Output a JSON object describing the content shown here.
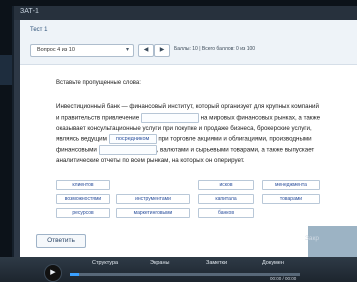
{
  "window": {
    "title": "ЗАТ-1"
  },
  "header": {
    "test_title": "Тест 1",
    "question_select": "Вопрос 4 из 10",
    "prev_label": "◀",
    "next_label": "▶",
    "scores": "Баллы: 10 | Всего баллов: 0 из 100"
  },
  "question": {
    "instruction": "Вставьте пропущенные слова:",
    "part1": "Инвестиционный банк — финансовый институт, который организует для крупных компаний и правительств привлечение",
    "part2": "на мировых финансовых рынках, а также оказывает консультационные услуги при покупке и продаже бизнеса, брокерские услуги, являясь ведущим",
    "blank2": "посредником",
    "part3": "при торговле акциями и облигациями, производными финансовыми",
    "part4": ", валютами и сырьевыми товарами, а также выпускает аналитические отчеты по всем рынкам, на которых он оперирует."
  },
  "word_bank": [
    "клиентов",
    "исков",
    "менеджмента",
    "возможностями",
    "инструментами",
    "капитала",
    "товарами",
    "ресурсов",
    "маркетинговыми",
    "банков"
  ],
  "footer": {
    "answer_label": "Ответить",
    "close_label": "Закр"
  },
  "player": {
    "tabs": [
      "Структура",
      "Экраны",
      "Заметки",
      "Докумен"
    ],
    "time": "00:00 / 00:00",
    "progress": 0.04,
    "play_icon": "play-icon"
  }
}
